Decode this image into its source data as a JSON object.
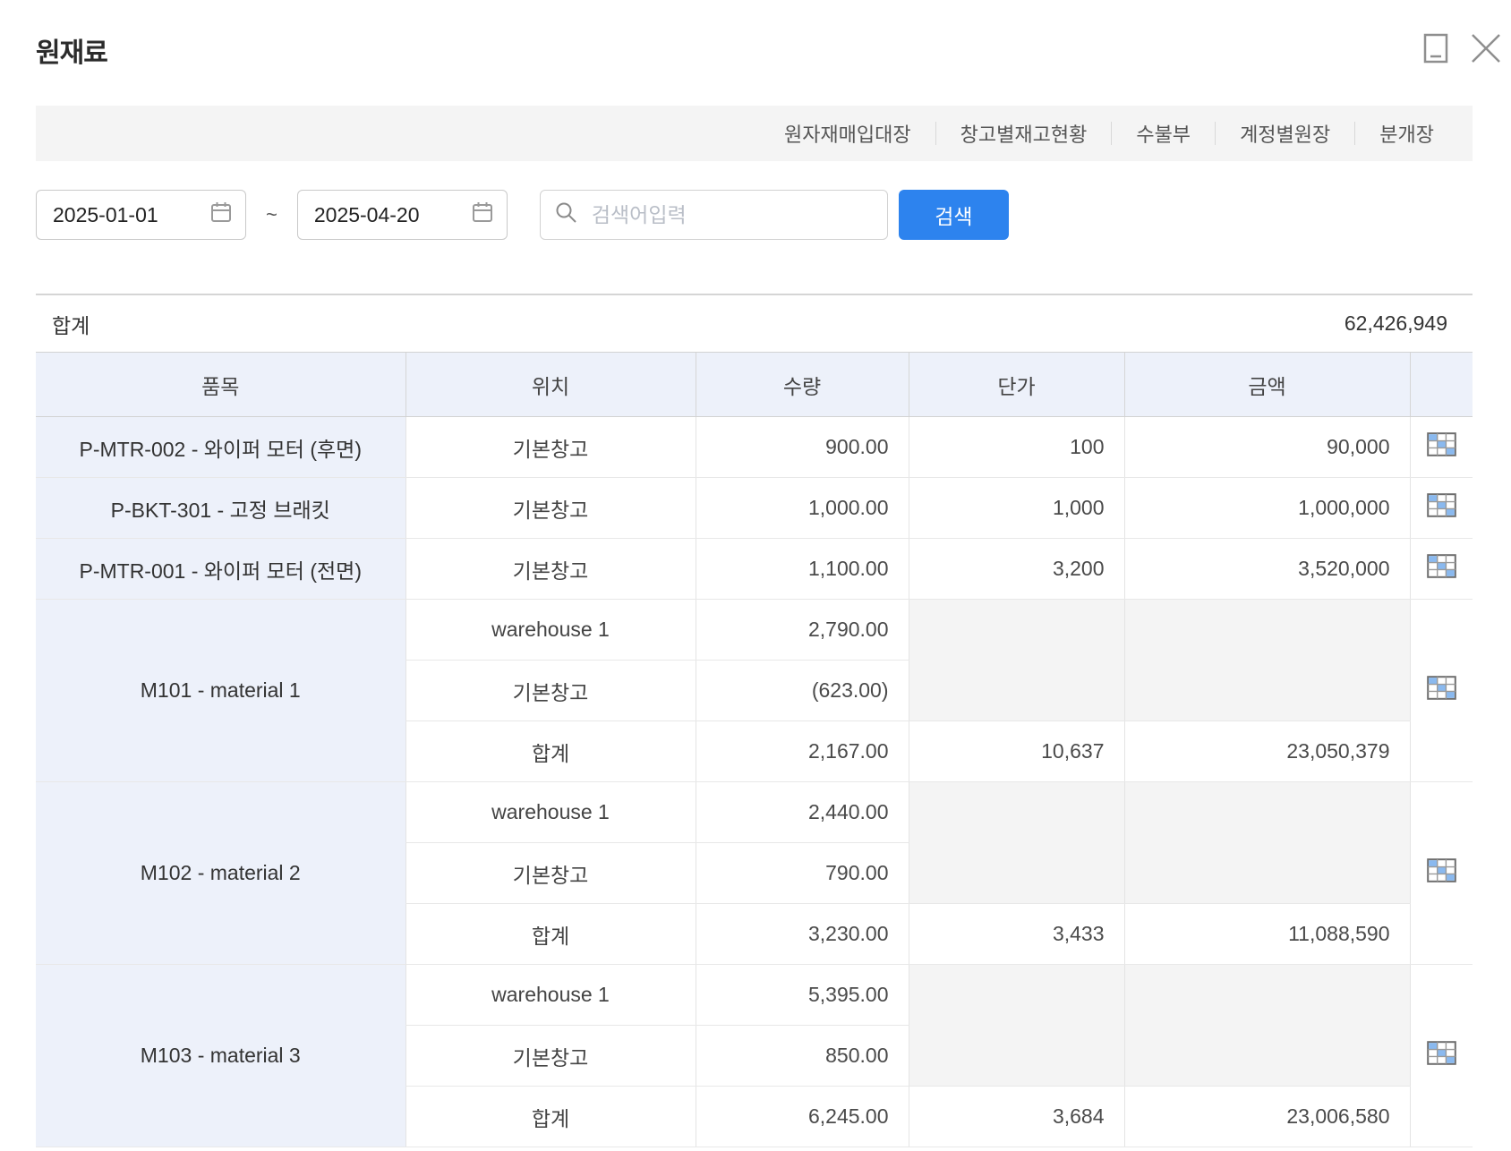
{
  "window": {
    "title": "원재료"
  },
  "nav": {
    "links": [
      "원자재매입대장",
      "창고별재고현황",
      "수불부",
      "계정별원장",
      "분개장"
    ]
  },
  "filters": {
    "date_from": "2025-01-01",
    "date_to": "2025-04-20",
    "range_separator": "~",
    "search": {
      "placeholder": "검색어입력"
    },
    "search_button": "검색"
  },
  "summary": {
    "label": "합계",
    "total": "62,426,949"
  },
  "table": {
    "columns": [
      "품목",
      "위치",
      "수량",
      "단가",
      "금액",
      ""
    ],
    "groups": [
      {
        "item": "P-MTR-002 - 와이퍼 모터 (후면)",
        "rows": [
          {
            "location": "기본창고",
            "qty": "900.00",
            "unit_price": "100",
            "amount": "90,000"
          }
        ]
      },
      {
        "item": "P-BKT-301 - 고정 브래킷",
        "rows": [
          {
            "location": "기본창고",
            "qty": "1,000.00",
            "unit_price": "1,000",
            "amount": "1,000,000"
          }
        ]
      },
      {
        "item": "P-MTR-001 - 와이퍼 모터 (전면)",
        "rows": [
          {
            "location": "기본창고",
            "qty": "1,100.00",
            "unit_price": "3,200",
            "amount": "3,520,000"
          }
        ]
      },
      {
        "item": "M101 - material 1",
        "rows": [
          {
            "location": "warehouse 1",
            "qty": "2,790.00"
          },
          {
            "location": "기본창고",
            "qty": "(623.00)"
          },
          {
            "location": "합계",
            "qty": "2,167.00",
            "unit_price": "10,637",
            "amount": "23,050,379",
            "subtotal": true
          }
        ]
      },
      {
        "item": "M102 - material 2",
        "rows": [
          {
            "location": "warehouse 1",
            "qty": "2,440.00"
          },
          {
            "location": "기본창고",
            "qty": "790.00"
          },
          {
            "location": "합계",
            "qty": "3,230.00",
            "unit_price": "3,433",
            "amount": "11,088,590",
            "subtotal": true
          }
        ]
      },
      {
        "item": "M103 - material 3",
        "rows": [
          {
            "location": "warehouse 1",
            "qty": "5,395.00"
          },
          {
            "location": "기본창고",
            "qty": "850.00"
          },
          {
            "location": "합계",
            "qty": "6,245.00",
            "unit_price": "3,684",
            "amount": "23,006,580",
            "subtotal": true
          }
        ]
      }
    ]
  },
  "colors": {
    "accent_blue": "#2d83ee",
    "header_bg": "#edf1fa",
    "bar_bg": "#f4f4f4",
    "merged_bg": "#f4f4f4",
    "icon_blue": "#8ab9ef"
  }
}
